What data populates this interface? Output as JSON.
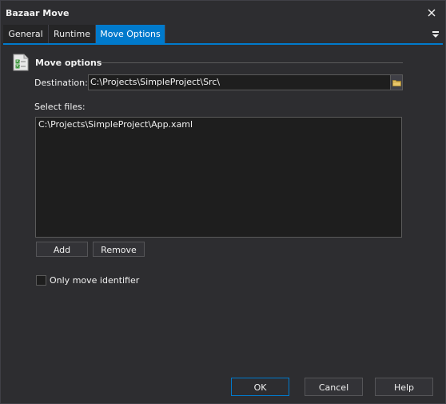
{
  "window": {
    "title": "Bazaar Move"
  },
  "tabs": [
    {
      "label": "General"
    },
    {
      "label": "Runtime"
    },
    {
      "label": "Move Options"
    }
  ],
  "group": {
    "title": "Move options"
  },
  "destination": {
    "label": "Destination:",
    "value": "C:\\Projects\\SimpleProject\\Src\\"
  },
  "files": {
    "label": "Select files:",
    "items": [
      "C:\\Projects\\SimpleProject\\App.xaml"
    ]
  },
  "buttons": {
    "add": "Add",
    "remove": "Remove",
    "ok": "OK",
    "cancel": "Cancel",
    "help": "Help"
  },
  "options": {
    "only_move_identifier": "Only move identifier"
  },
  "colors": {
    "accent": "#007acc",
    "background": "#2d2d30",
    "field": "#1e1e1e"
  }
}
